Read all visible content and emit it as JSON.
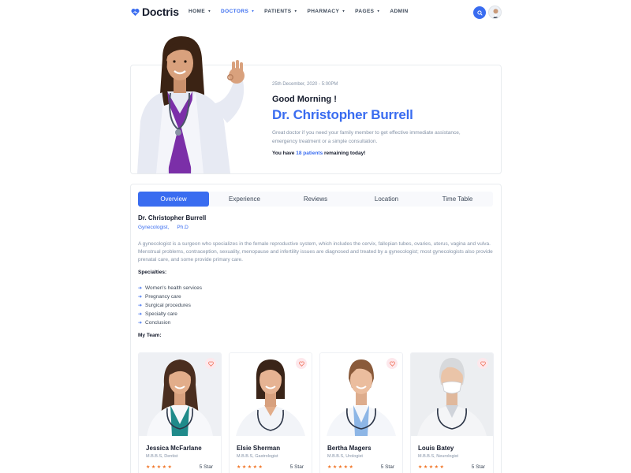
{
  "brand": {
    "name": "Doctris",
    "accent": "#396cf0",
    "heading": "#161c2d",
    "muted": "#8492a6"
  },
  "nav": [
    {
      "label": "HOME",
      "active": false,
      "dropdown": true
    },
    {
      "label": "DOCTORS",
      "active": true,
      "dropdown": true
    },
    {
      "label": "PATIENTS",
      "active": false,
      "dropdown": true
    },
    {
      "label": "PHARMACY",
      "active": false,
      "dropdown": true
    },
    {
      "label": "PAGES",
      "active": false,
      "dropdown": true
    },
    {
      "label": "ADMIN",
      "active": false,
      "dropdown": false
    }
  ],
  "header_icons": {
    "search": "search-icon",
    "profile": "user-avatar"
  },
  "hero": {
    "date": "25th December, 2020 - 5:00PM",
    "greeting": "Good Morning !",
    "doctor_name": "Dr. Christopher Burrell",
    "description": "Great doctor if you need your family member to get effective immediate assistance, emergency treatment or a simple consultation.",
    "note_prefix": "You have ",
    "note_highlight": "18 patients",
    "note_suffix": " remaining today!"
  },
  "tabs": [
    {
      "label": "Overview",
      "active": true
    },
    {
      "label": "Experience",
      "active": false
    },
    {
      "label": "Reviews",
      "active": false
    },
    {
      "label": "Location",
      "active": false
    },
    {
      "label": "Time Table",
      "active": false
    }
  ],
  "overview": {
    "name": "Dr. Christopher Burrell",
    "tags": [
      "Gynecologist,",
      "Ph.D"
    ],
    "about": "A gynecologist is a surgeon who specializes in the female reproductive system, which includes the cervix, fallopian tubes, ovaries, uterus, vagina and vulva. Menstrual problems, contraception, sexuality, menopause and infertility issues are diagnosed and treated by a gynecologist; most gynecologists also provide prenatal care, and some provide primary care.",
    "specialties_title": "Specialties:",
    "specialties": [
      "Women's health services",
      "Pregnancy care",
      "Surgical procedures",
      "Specialty care",
      "Conclusion"
    ],
    "team_title": "My Team:"
  },
  "team": [
    {
      "name": "Jessica McFarlane",
      "degree": "M.B.B.S, Dentist",
      "stars": 5,
      "rating": "5 Star"
    },
    {
      "name": "Elsie Sherman",
      "degree": "M.B.B.S, Gastrologist",
      "stars": 5,
      "rating": "5 Star"
    },
    {
      "name": "Bertha Magers",
      "degree": "M.B.B.S, Urologist",
      "stars": 5,
      "rating": "5 Star"
    },
    {
      "name": "Louis Batey",
      "degree": "M.B.B.S, Neurologist",
      "stars": 5,
      "rating": "5 Star"
    }
  ]
}
